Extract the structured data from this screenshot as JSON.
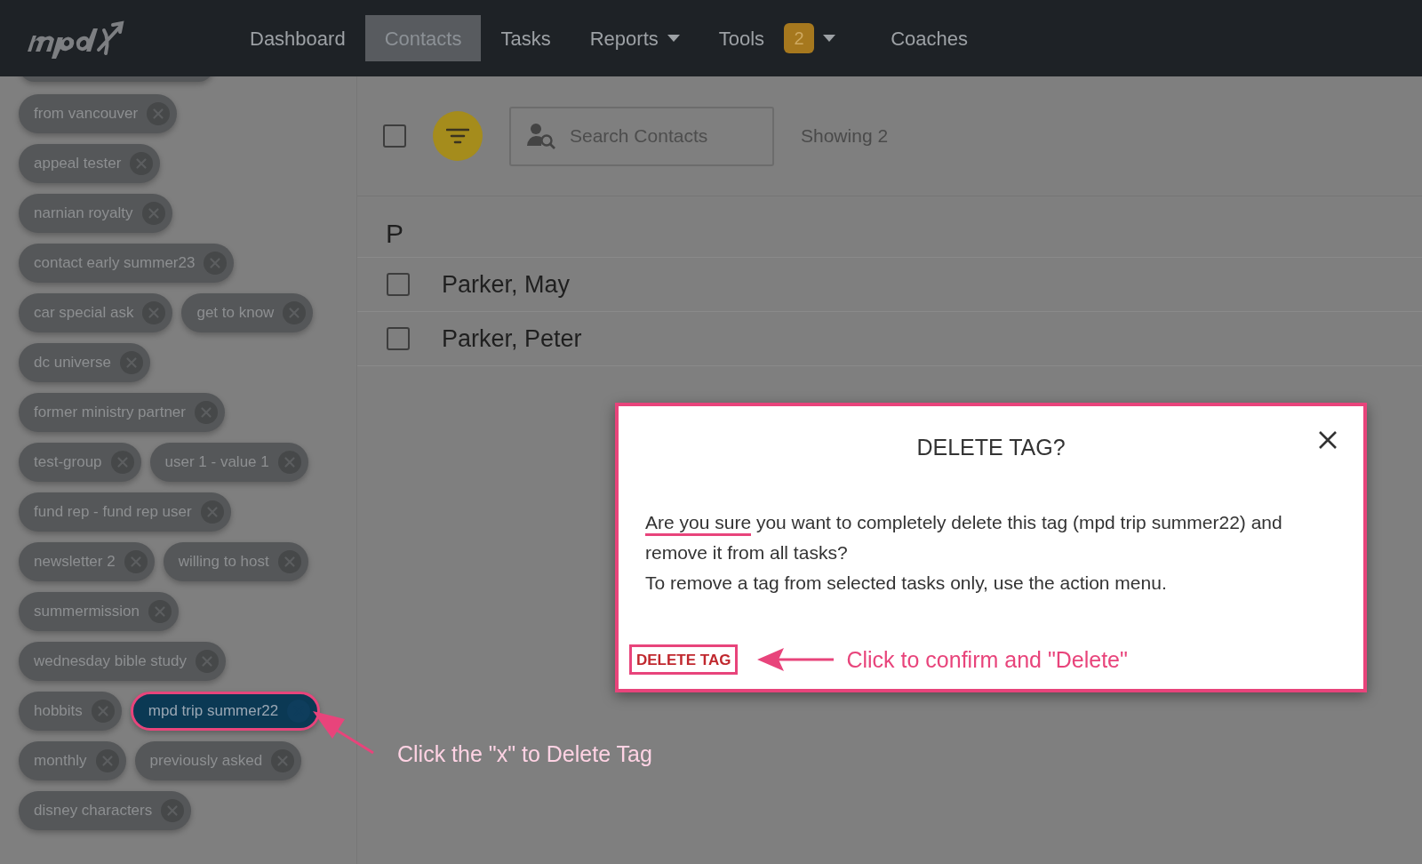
{
  "nav": {
    "items": [
      {
        "label": "Dashboard",
        "selected": false,
        "dropdown": false
      },
      {
        "label": "Contacts",
        "selected": true,
        "dropdown": false
      },
      {
        "label": "Tasks",
        "selected": false,
        "dropdown": false
      },
      {
        "label": "Reports",
        "selected": false,
        "dropdown": true
      },
      {
        "label": "Tools",
        "selected": false,
        "dropdown": true,
        "badge": "2"
      },
      {
        "label": "Coaches",
        "selected": false,
        "dropdown": false
      }
    ]
  },
  "tag_rows": [
    [
      {
        "label": "from vancouver",
        "selected": false
      }
    ],
    [
      {
        "label": "appeal tester",
        "selected": false
      }
    ],
    [
      {
        "label": "narnian royalty",
        "selected": false
      }
    ],
    [
      {
        "label": "contact early summer23",
        "selected": false
      }
    ],
    [
      {
        "label": "car special ask",
        "selected": false
      },
      {
        "label": "get to know",
        "selected": false
      }
    ],
    [
      {
        "label": "dc universe",
        "selected": false
      }
    ],
    [
      {
        "label": "former ministry partner",
        "selected": false
      }
    ],
    [
      {
        "label": "test-group",
        "selected": false
      },
      {
        "label": "user 1 - value 1",
        "selected": false
      }
    ],
    [
      {
        "label": "fund rep - fund rep user",
        "selected": false
      }
    ],
    [
      {
        "label": "newsletter 2",
        "selected": false
      },
      {
        "label": "willing to host",
        "selected": false
      }
    ],
    [
      {
        "label": "summermission",
        "selected": false
      }
    ],
    [
      {
        "label": "wednesday bible study",
        "selected": false
      }
    ],
    [
      {
        "label": "hobbits",
        "selected": false
      },
      {
        "label": "mpd trip summer22",
        "selected": true
      }
    ],
    [
      {
        "label": "monthly",
        "selected": false
      },
      {
        "label": "previously asked",
        "selected": false
      }
    ],
    [
      {
        "label": "disney characters",
        "selected": false
      }
    ]
  ],
  "sidebar_note": "Click the \"x\" to Delete Tag",
  "toolbar": {
    "select_all_checked": false,
    "search": {
      "placeholder": "Search Contacts"
    },
    "count": "Showing 2"
  },
  "contacts": {
    "group": "P",
    "rows": [
      {
        "name": "Parker, May",
        "checked": false
      },
      {
        "name": "Parker, Peter",
        "checked": false
      }
    ]
  },
  "dialog": {
    "title": "DELETE TAG?",
    "paragraphs": [
      {
        "underlined": "Are you sure",
        "rest": "you want to completely delete this tag (mpd trip summer22) and remove it from all tasks?"
      },
      {
        "rest": "To remove a tag from selected tasks only, use the action menu."
      }
    ],
    "confirm_button": "DELETE TAG",
    "note": "Click to confirm and \"Delete\""
  }
}
